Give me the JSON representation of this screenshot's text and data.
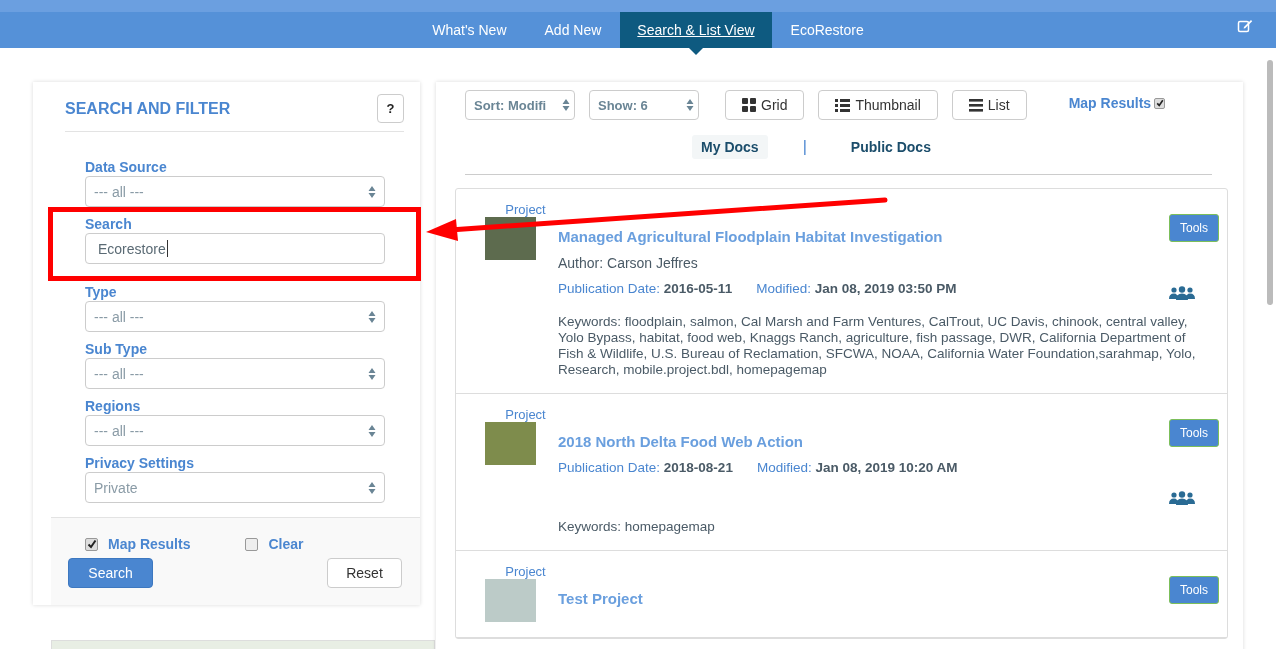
{
  "nav": {
    "tabs": [
      {
        "label": "What's New",
        "selected": false
      },
      {
        "label": "Add New",
        "selected": false
      },
      {
        "label": "Search & List View",
        "selected": true
      },
      {
        "label": "EcoRestore",
        "selected": false
      }
    ]
  },
  "filter": {
    "title": "SEARCH AND FILTER",
    "help": "?",
    "fields": [
      {
        "label": "Data Source",
        "kind": "select",
        "value": "--- all ---"
      },
      {
        "label": "Search",
        "kind": "input",
        "value": "Ecorestore"
      },
      {
        "label": "Type",
        "kind": "select",
        "value": "--- all ---"
      },
      {
        "label": "Sub Type",
        "kind": "select",
        "value": "--- all ---"
      },
      {
        "label": "Regions",
        "kind": "select",
        "value": "--- all ---"
      },
      {
        "label": "Privacy Settings",
        "kind": "select",
        "value": "Private"
      }
    ],
    "options": [
      {
        "label": "Map Results",
        "checked": true
      },
      {
        "label": "Clear",
        "checked": false
      }
    ],
    "buttons": [
      {
        "label": "Search",
        "kind": "primary"
      },
      {
        "label": "Reset",
        "kind": "default"
      }
    ]
  },
  "toolbar": {
    "sort": "Sort: Modifi",
    "show": "Show: 6",
    "views": [
      {
        "label": "Grid",
        "kind": "grid"
      },
      {
        "label": "Thumbnail",
        "kind": "thumbnail"
      },
      {
        "label": "List",
        "kind": "list"
      }
    ],
    "map_results": {
      "label": "Map Results",
      "checked": true
    }
  },
  "doc_tabs": {
    "tabs": [
      {
        "label": "My Docs",
        "selected": true
      },
      {
        "label": "Public Docs",
        "selected": false
      }
    ],
    "separator": "|"
  },
  "results": [
    {
      "type": "Project",
      "title": "Managed Agricultural Floodplain Habitat Investigation",
      "author": "Author: Carson Jeffres",
      "publication_label": "Publication Date:",
      "publication_date": "2016-05-11",
      "modified_label": "Modified:",
      "modified": "Jan 08, 2019 03:50 PM",
      "keywords": "Keywords: floodplain, salmon, Cal Marsh and Farm Ventures, CalTrout, UC Davis, chinook, central valley, Yolo Bypass, habitat, food web, Knaggs Ranch, agriculture, fish passage, DWR, California Department of Fish & Wildlife, U.S. Bureau of Reclamation, SFCWA, NOAA, California Water Foundation,sarahmap, Yolo, Research, mobile.project.bdl, homepagemap",
      "tools": "Tools"
    },
    {
      "type": "Project",
      "title": "2018 North Delta Food Web Action",
      "publication_label": "Publication Date:",
      "publication_date": "2018-08-21",
      "modified_label": "Modified:",
      "modified": "Jan 08, 2019 10:20 AM",
      "keywords": "Keywords: homepagemap",
      "tools": "Tools"
    },
    {
      "type": "Project",
      "title": "Test Project",
      "tools": "Tools"
    }
  ]
}
